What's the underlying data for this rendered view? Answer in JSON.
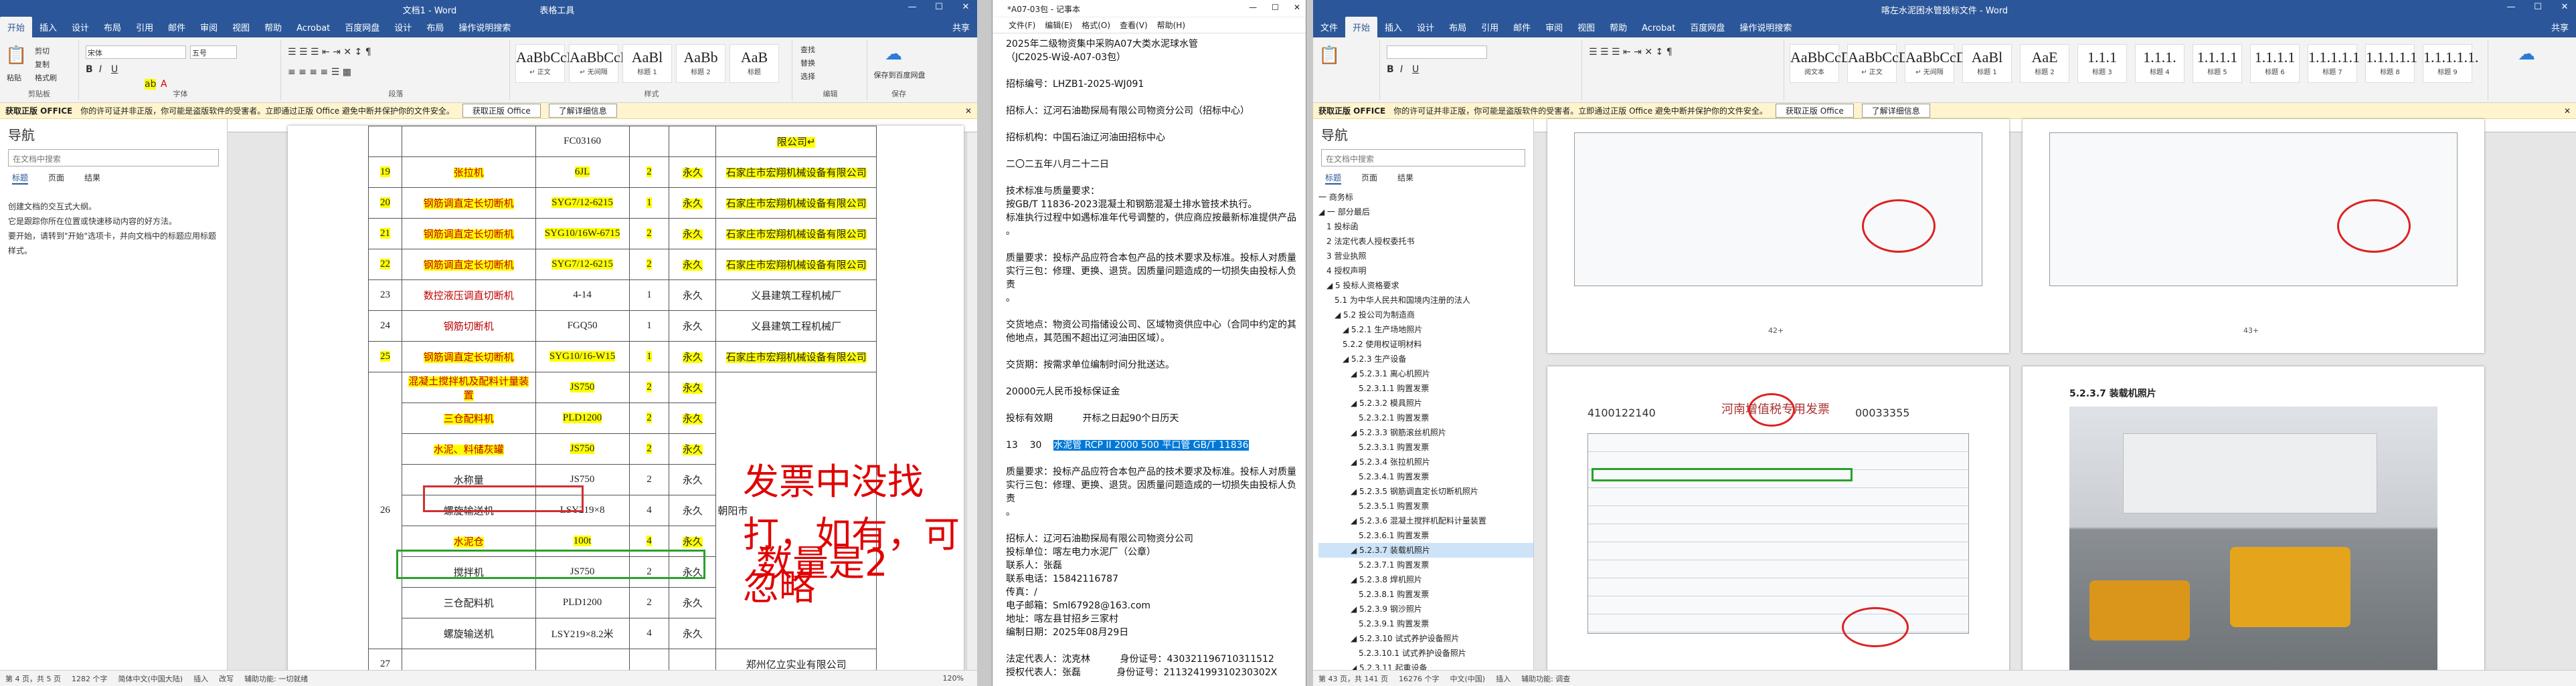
{
  "left_word": {
    "title": "文档1 - Word",
    "table_tools": "表格工具",
    "share": "共享",
    "tabs": [
      "开始",
      "插入",
      "设计",
      "布局",
      "引用",
      "邮件",
      "审阅",
      "视图",
      "帮助",
      "Acrobat",
      "百度网盘",
      "设计",
      "布局",
      "操作说明搜索"
    ],
    "ribbon": {
      "clipboard": "剪贴板",
      "paste": "粘贴",
      "cut": "剪切",
      "copy": "复制",
      "format_painter": "格式刷",
      "font_group": "字体",
      "font_name": "宋体",
      "font_size": "五号",
      "paragraph_group": "段落",
      "styles_group": "样式",
      "styles": [
        {
          "preview": "AaBbCcDd",
          "name": "↵ 正文"
        },
        {
          "preview": "AaBbCcDd",
          "name": "↵ 无间隔"
        },
        {
          "preview": "AaBl",
          "name": "标题 1"
        },
        {
          "preview": "AaBb",
          "name": "标题 2"
        },
        {
          "preview": "AaB",
          "name": "标题"
        }
      ],
      "editing": [
        "查找",
        "替换",
        "选择"
      ],
      "editing_group": "编辑",
      "save_label": "保存到百度网盘",
      "save_group": "保存"
    },
    "infobar": {
      "label": "获取正版 OFFICE",
      "message": "你的许可证并非正版，你可能是盗版软件的受害者。立即通过正版 Office 避免中断并保护你的文件安全。",
      "btn1": "获取正版 Office",
      "btn2": "了解详细信息"
    },
    "nav": {
      "title": "导航",
      "search_placeholder": "在文档中搜索",
      "tabs": [
        "标题",
        "页面",
        "结果"
      ],
      "text1": "创建文档的交互式大纲。",
      "text2": "它是跟踪你所在位置或快速移动内容的好方法。",
      "text3": "要开始，请转到\"开始\"选项卡，并向文档中的标题应用标题样式。"
    },
    "table_rows": [
      {
        "no": "",
        "name": "",
        "model": "FC03160",
        "qty": "",
        "duration": "",
        "supplier": "限公司↵",
        "hlname": false,
        "hlmodel": false,
        "hlsup": true
      },
      {
        "no": "19",
        "name": "张拉机",
        "model": "6JL",
        "qty": "2",
        "duration": "永久",
        "supplier": "石家庄市宏翔机械设备有限公司",
        "hlname": true,
        "hlmodel": true,
        "hlsup": true
      },
      {
        "no": "20",
        "name": "钢筋调直定长切断机",
        "model": "SYG7/12-6215",
        "qty": "1",
        "duration": "永久",
        "supplier": "石家庄市宏翔机械设备有限公司",
        "hlname": true,
        "hlmodel": true,
        "hlsup": true
      },
      {
        "no": "21",
        "name": "钢筋调直定长切断机",
        "model": "SYG10/16W-6715",
        "qty": "2",
        "duration": "永久",
        "supplier": "石家庄市宏翔机械设备有限公司",
        "hlname": true,
        "hlmodel": true,
        "hlsup": true
      },
      {
        "no": "22",
        "name": "钢筋调直定长切断机",
        "model": "SYG7/12-6215",
        "qty": "2",
        "duration": "永久",
        "supplier": "石家庄市宏翔机械设备有限公司",
        "hlname": true,
        "hlmodel": true,
        "hlsup": true
      },
      {
        "no": "23",
        "name": "数控液压调直切断机",
        "model": "4-14",
        "qty": "1",
        "duration": "永久",
        "supplier": "义县建筑工程机械厂",
        "hlname": false,
        "hlmodel": false,
        "hlsup": false
      },
      {
        "no": "24",
        "name": "钢筋切断机",
        "model": "FGQ50",
        "qty": "1",
        "duration": "永久",
        "supplier": "义县建筑工程机械厂",
        "hlname": false,
        "hlmodel": false,
        "hlsup": false
      },
      {
        "no": "25",
        "name": "钢筋调直定长切断机",
        "model": "SYG10/16-W15",
        "qty": "1",
        "duration": "永久",
        "supplier": "石家庄市宏翔机械设备有限公司",
        "hlname": true,
        "hlmodel": true,
        "hlsup": true
      }
    ],
    "group26": {
      "no": "26",
      "supplier_partial": "朝阳市",
      "items": [
        {
          "name": "混凝土搅拌机及配料计量装置",
          "model": "JS750",
          "qty": "2",
          "duration": "永久",
          "hl": true
        },
        {
          "name": "三仓配料机",
          "model": "PLD1200",
          "qty": "2",
          "duration": "永久",
          "hl": true
        },
        {
          "name": "水泥、料储灰罐",
          "model": "JS750",
          "qty": "2",
          "duration": "永久",
          "hl": true
        },
        {
          "name": "水称量",
          "model": "JS750",
          "qty": "2",
          "duration": "永久",
          "hl": false
        },
        {
          "name": "螺旋输送机",
          "model": "LSY219×8",
          "qty": "4",
          "duration": "永久",
          "hl": false
        },
        {
          "name": "水泥仓",
          "model": "100t",
          "qty": "4",
          "duration": "永久",
          "hl": true
        },
        {
          "name": "搅拌机",
          "model": "JS750",
          "qty": "2",
          "duration": "永久",
          "hl": false
        },
        {
          "name": "三仓配料机",
          "model": "PLD1200",
          "qty": "2",
          "duration": "永久",
          "hl": false
        },
        {
          "name": "螺旋输送机",
          "model": "LSY219×8.2米",
          "qty": "4",
          "duration": "永久",
          "hl": false
        }
      ]
    },
    "row27": {
      "no": "27",
      "supplier": "郑州亿立实业有限公司"
    },
    "annotations": {
      "line1": "发票中没找打，如有，可忽略",
      "line2": "数量是2"
    },
    "status": {
      "page": "第 4 页，共 5 页",
      "words": "1282 个字",
      "lang": "简体中文(中国大陆)",
      "insert": "插入",
      "mode": "改写",
      "accessibility": "辅助功能: 一切就绪",
      "zoom": "120%"
    }
  },
  "notepad": {
    "title": "*A07-03包 - 记事本",
    "menu": [
      "文件(F)",
      "编辑(E)",
      "格式(O)",
      "查看(V)",
      "帮助(H)"
    ],
    "lines": [
      "2025年二级物资集中采购A07大类水泥球水管",
      "（JC2025-W设-A07-03包）",
      "",
      "招标编号：LHZB1-2025-WJ091",
      "",
      "招标人：辽河石油勘探局有限公司物资分公司（招标中心）",
      "",
      "招标机构：中国石油辽河油田招标中心",
      "",
      "二〇二五年八月二十二日",
      "",
      "技术标准与质量要求：",
      "按GB/T 11836-2023混凝土和钢筋混凝土排水管技术执行。",
      "标准执行过程中如遇标准年代号调整的，供应商应按最新标准提供产品",
      "。",
      "",
      "质量要求：投标产品应符合本包产品的技术要求及标准。投标人对质量",
      "实行三包：修理、更换、退货。因质量问题造成的一切损失由投标人负责",
      "。",
      "",
      "交货地点：物资公司指储设公司、区域物资供应中心（合同中约定的其",
      "他地点，其范围不超出辽河油田区域）。",
      "",
      "交货期：按需求单位编制时间分批送达。",
      "",
      "20000元人民币投标保证金",
      "",
      "投标有效期          开标之日起90个日历天",
      ""
    ],
    "selected_line_prefix": "13    30    ",
    "selected_text": "水泥管 RCP II 2000 500 平口管 GB/T 11836",
    "lines_after": [
      "",
      "质量要求：投标产品应符合本包产品的技术要求及标准。投标人对质量",
      "实行三包：修理、更换、退货。因质量问题造成的一切损失由投标人负责",
      "。",
      "",
      "招标人：辽河石油勘探局有限公司物资分公司",
      "投标单位：喀左电力水泥厂（公章）",
      "联系人：张磊",
      "联系电话：15842116787",
      "传真：/",
      "电子邮箱：Sml67928@163.com",
      "地址：喀左县甘招乡三家村",
      "编制日期：2025年08月29日",
      "",
      "法定代表人：沈克林          身份证号：430321196710311512",
      "授权代表人：张磊            身份证号：211324199310230302X"
    ]
  },
  "right_word": {
    "title": "喀左水泥困水管投标文件 - Word",
    "tabs": [
      "文件",
      "开始",
      "插入",
      "设计",
      "布局",
      "引用",
      "邮件",
      "审阅",
      "视图",
      "帮助",
      "Acrobat",
      "百度网盘",
      "操作说明搜索"
    ],
    "share": "共享",
    "styles": [
      {
        "preview": "AaBbCcDd",
        "name": "阅文本"
      },
      {
        "preview": "AaBbCcDd",
        "name": "↵ 正文"
      },
      {
        "preview": "AaBbCcDd",
        "name": "↵ 无间隔"
      },
      {
        "preview": "AaBl",
        "name": "标题 1"
      },
      {
        "preview": "AaE",
        "name": "标题 2"
      },
      {
        "preview": "1.1.1",
        "name": "标题 3"
      },
      {
        "preview": "1.1.1.",
        "name": "标题 4"
      },
      {
        "preview": "1.1.1.1",
        "name": "标题 5"
      },
      {
        "preview": "1.1.1.1",
        "name": "标题 6"
      },
      {
        "preview": "1.1.1.1.1",
        "name": "标题 7"
      },
      {
        "preview": "1.1.1.1.1",
        "name": "标题 8"
      },
      {
        "preview": "1.1.1.1.1.",
        "name": "标题 9"
      }
    ],
    "infobar": {
      "label": "获取正版 OFFICE",
      "message": "你的许可证并非正版，你可能是盗版软件的受害者。立即通过正版 Office 避免中断并保护你的文件安全。",
      "btn1": "获取正版 Office",
      "btn2": "了解详细信息"
    },
    "nav": {
      "title": "导航",
      "search_placeholder": "在文档中搜索",
      "tabs": [
        "标题",
        "页面",
        "结果"
      ],
      "tree": [
        {
          "t": "一 商务标",
          "lvl": 0
        },
        {
          "t": "◢ 一 部分最后",
          "lvl": 0
        },
        {
          "t": "1 投标函",
          "lvl": 1
        },
        {
          "t": "2 法定代表人授权委托书",
          "lvl": 1
        },
        {
          "t": "3 营业执照",
          "lvl": 1
        },
        {
          "t": "4 授权声明",
          "lvl": 1
        },
        {
          "t": "◢ 5 投标人资格要求",
          "lvl": 1
        },
        {
          "t": "5.1 为中华人民共和国境内注册的法人",
          "lvl": 2
        },
        {
          "t": "◢ 5.2 投公司为制造商",
          "lvl": 2
        },
        {
          "t": "◢ 5.2.1 生产场地照片",
          "lvl": 3
        },
        {
          "t": "5.2.2 使用权证明材料",
          "lvl": 3
        },
        {
          "t": "◢ 5.2.3 生产设备",
          "lvl": 3
        },
        {
          "t": "◢ 5.2.3.1 离心机照片",
          "lvl": 4
        },
        {
          "t": "5.2.3.1.1 购置发票",
          "lvl": 5
        },
        {
          "t": "◢ 5.2.3.2 模具照片",
          "lvl": 4
        },
        {
          "t": "5.2.3.2.1 购置发票",
          "lvl": 5
        },
        {
          "t": "◢ 5.2.3.3 钢筋滚丝机照片",
          "lvl": 4
        },
        {
          "t": "5.2.3.3.1 购置发票",
          "lvl": 5
        },
        {
          "t": "◢ 5.2.3.4 张拉机照片",
          "lvl": 4
        },
        {
          "t": "5.2.3.4.1 购置发票",
          "lvl": 5
        },
        {
          "t": "◢ 5.2.3.5 钢筋调直定长切断机照片",
          "lvl": 4
        },
        {
          "t": "5.2.3.5.1 购置发票",
          "lvl": 5
        },
        {
          "t": "◢ 5.2.3.6 混凝土搅拌机配料计量装置",
          "lvl": 4
        },
        {
          "t": "5.2.3.6.1 购置发票",
          "lvl": 5
        },
        {
          "t": "◢ 5.2.3.7 装载机照片",
          "lvl": 4,
          "sel": true
        },
        {
          "t": "5.2.3.7.1 购置发票",
          "lvl": 5
        },
        {
          "t": "◢ 5.2.3.8 焊机照片",
          "lvl": 4
        },
        {
          "t": "5.2.3.8.1 购置发票",
          "lvl": 5
        },
        {
          "t": "◢ 5.2.3.9 钢沙照片",
          "lvl": 4
        },
        {
          "t": "5.2.3.9.1 购置发票",
          "lvl": 5
        },
        {
          "t": "◢ 5.2.3.10 试式养护设备照片",
          "lvl": 4
        },
        {
          "t": "5.2.3.10.1 试式养护设备照片",
          "lvl": 5
        },
        {
          "t": "◢ 5.2.3.11 起重设备",
          "lvl": 4
        }
      ]
    },
    "page_texts": {
      "p1_num": "42+",
      "p2_num": "43+",
      "invoice_no": "4100122140",
      "invoice_title": "河南增值税专用发票",
      "invoice_code": "00033355",
      "section": "5.2.3.7  装载机照片"
    },
    "status": {
      "page": "第 43 页，共 141 页",
      "words": "16276 个字",
      "lang": "中文(中国)",
      "mode": "插入",
      "accessibility": "辅助功能: 调查"
    }
  }
}
